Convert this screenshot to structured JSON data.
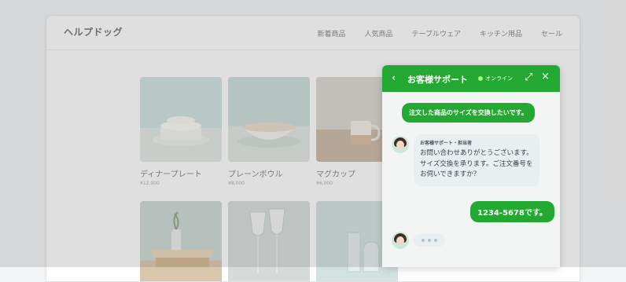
{
  "site": {
    "logo": "ヘルプドッグ",
    "nav": [
      "新着商品",
      "人気商品",
      "テーブルウェア",
      "キッチン用品",
      "セール"
    ]
  },
  "products": [
    {
      "name": "ディナープレート",
      "price": "¥12,000"
    },
    {
      "name": "プレーンボウル",
      "price": "¥8,000"
    },
    {
      "name": "マグカップ",
      "price": "¥6,000"
    }
  ],
  "chat": {
    "title": "お客様サポート",
    "status": "オンライン",
    "back_icon": "‹",
    "expand_icon": "⤢",
    "close_icon": "×",
    "messages": {
      "user1": "注文した商品のサイズを交換したいです。",
      "agent_name": "お客様サポート・担当者",
      "agent_text": "お問い合わせありがとうございます。サイズ交換を承ります。ご注文番号をお伺いできますか？",
      "user2": "1234-5678です。"
    }
  },
  "colors": {
    "accent": "#23a832",
    "online_dot": "#9cff7a"
  }
}
